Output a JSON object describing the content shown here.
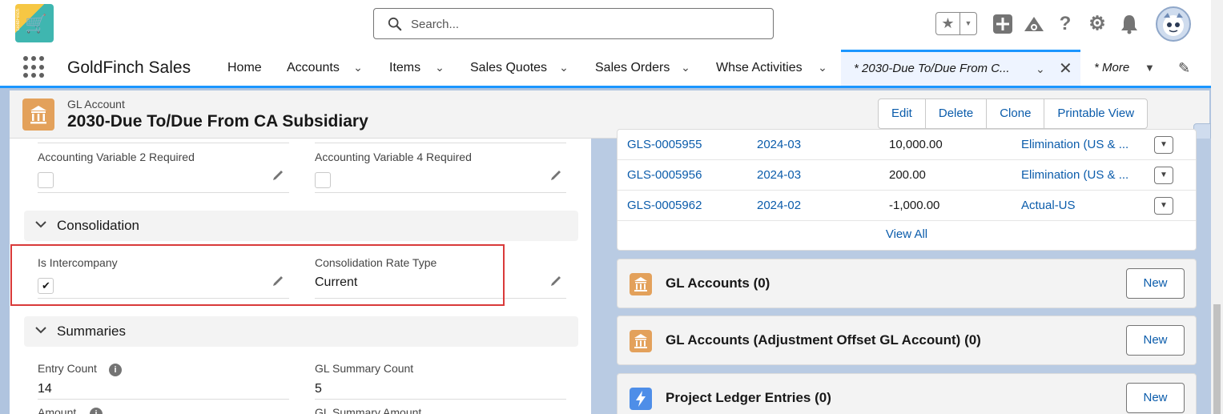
{
  "global_header": {
    "app_logo_text": "GoldFinch",
    "search": {
      "placeholder": "Search..."
    },
    "icons": [
      "star-icon",
      "add-icon",
      "trailhead-icon",
      "help-icon",
      "gear-icon",
      "bell-icon",
      "avatar"
    ]
  },
  "nav": {
    "app_name": "GoldFinch Sales",
    "items": [
      {
        "label": "Home",
        "has_menu": false
      },
      {
        "label": "Accounts",
        "has_menu": true
      },
      {
        "label": "Items",
        "has_menu": true
      },
      {
        "label": "Sales Quotes",
        "has_menu": true
      },
      {
        "label": "Sales Orders",
        "has_menu": true
      },
      {
        "label": "Whse Activities",
        "has_menu": true
      }
    ],
    "active_tab": {
      "label": "* 2030-Due To/Due From C..."
    },
    "more_label": "* More"
  },
  "record": {
    "object_type": "GL Account",
    "title": "2030-Due To/Due From CA Subsidiary",
    "actions": [
      "Edit",
      "Delete",
      "Clone",
      "Printable View"
    ]
  },
  "details": {
    "fields_top": [
      {
        "label": "Accounting Variable 2 Required",
        "checked": false
      },
      {
        "label": "Accounting Variable 4 Required",
        "checked": false
      }
    ],
    "consolidation": {
      "section_title": "Consolidation",
      "is_intercompany_label": "Is Intercompany",
      "is_intercompany_checked": true,
      "rate_type_label": "Consolidation Rate Type",
      "rate_type_value": "Current"
    },
    "summaries": {
      "section_title": "Summaries",
      "entry_count_label": "Entry Count",
      "entry_count_value": "14",
      "gl_summary_count_label": "GL Summary Count",
      "gl_summary_count_value": "5",
      "amount_label": "Amount",
      "gl_summary_amount_label": "GL Summary Amount"
    }
  },
  "related": {
    "entries": [
      {
        "id": "GLS-0005955",
        "period": "2024-03",
        "amount": "10,000.00",
        "ledger": "Elimination (US & ..."
      },
      {
        "id": "GLS-0005956",
        "period": "2024-03",
        "amount": "200.00",
        "ledger": "Elimination (US & ..."
      },
      {
        "id": "GLS-0005962",
        "period": "2024-02",
        "amount": "-1,000.00",
        "ledger": "Actual-US"
      }
    ],
    "view_all": "View All",
    "lists": [
      {
        "title": "GL Accounts (0)",
        "button": "New",
        "icon_color": "#e3a15b"
      },
      {
        "title": "GL Accounts (Adjustment Offset GL Account) (0)",
        "button": "New",
        "icon_color": "#e3a15b"
      },
      {
        "title": "Project Ledger Entries (0)",
        "button": "New",
        "icon_color": "#4e8ee8"
      }
    ]
  }
}
